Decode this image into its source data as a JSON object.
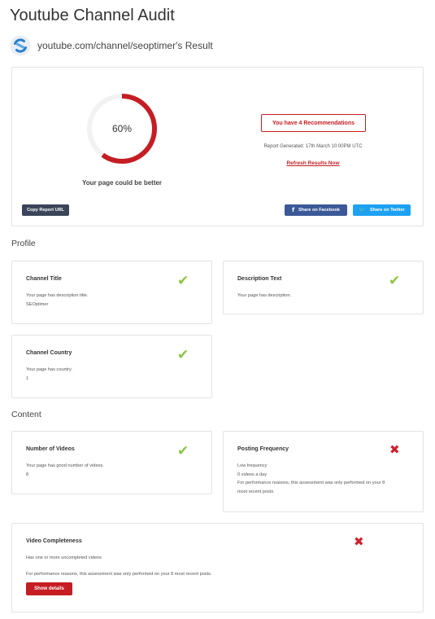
{
  "header": {
    "title": "Youtube Channel Audit",
    "site_result": "youtube.com/channel/seoptimer's Result"
  },
  "summary": {
    "score_label": "60%",
    "score_value": 60,
    "caption": "Your page could be better",
    "recommendations_label": "You have 4 Recommendations",
    "report_generated": "Report Generated: 17th March 10:00PM UTC",
    "refresh_label": "Refresh Results Now",
    "copy_label": "Copy Report URL",
    "facebook_label": "Share on Facebook",
    "twitter_label": "Share on Twitter",
    "facebook_icon": "f",
    "twitter_icon": "🐦",
    "ring_color": "#c51d23"
  },
  "sections": {
    "profile": {
      "title": "Profile",
      "channel_title": {
        "title": "Channel Title",
        "line1": "Your page has description title.",
        "line2": "SEOptimer",
        "status": "pass"
      },
      "description_text": {
        "title": "Description Text",
        "line1": "Your page has description.",
        "status": "pass"
      },
      "channel_country": {
        "title": "Channel Country",
        "line1": "Your page has country.",
        "line2": "1",
        "status": "pass"
      }
    },
    "content": {
      "title": "Content",
      "number_of_videos": {
        "title": "Number of Videos",
        "line1": "Your page has good number of videos.",
        "line2": "8",
        "status": "pass"
      },
      "posting_frequency": {
        "title": "Posting Frequency",
        "line1": "Low frequency",
        "line2": "0 videos a day",
        "line3": "For performance reasons, this assessment was only performed on your 8",
        "line4": "most recent posts.",
        "status": "fail"
      },
      "video_completeness": {
        "title": "Video Completeness",
        "line1": "Has one or more uncompleted videos",
        "line2": "For performance reasons, this assessment was only performed on your 8 most recent posts.",
        "button_label": "Show details",
        "status": "fail"
      }
    }
  },
  "icons": {
    "pass": "✔",
    "fail": "✖"
  },
  "colors": {
    "pass": "#8cc63f",
    "fail": "#d0202b",
    "brand_red": "#c51d23"
  }
}
